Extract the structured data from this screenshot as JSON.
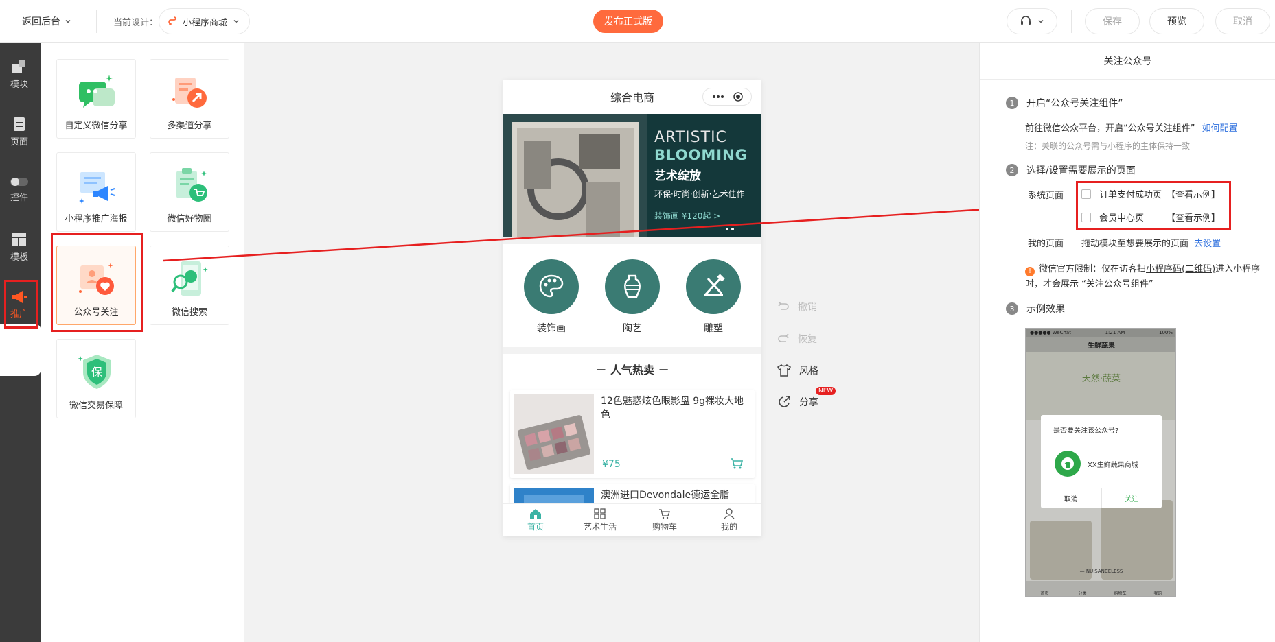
{
  "topbar": {
    "back_label": "返回后台",
    "current_design_label": "当前设计：",
    "design_name": "小程序商城",
    "publish_label": "发布正式版",
    "save_label": "保存",
    "preview_label": "预览",
    "cancel_label": "取消"
  },
  "leftnav": {
    "items": [
      {
        "label": "模块",
        "icon": "module-icon"
      },
      {
        "label": "页面",
        "icon": "page-icon"
      },
      {
        "label": "控件",
        "icon": "toggle-icon"
      },
      {
        "label": "模板",
        "icon": "template-icon"
      },
      {
        "label": "推广",
        "icon": "megaphone-icon",
        "active": true
      }
    ]
  },
  "components": [
    {
      "label": "自定义微信分享",
      "icon": "wechat-share-icon"
    },
    {
      "label": "多渠道分享",
      "icon": "multi-channel-share-icon"
    },
    {
      "label": "小程序推广海报",
      "icon": "promo-poster-icon"
    },
    {
      "label": "微信好物圈",
      "icon": "wechat-goods-circle-icon"
    },
    {
      "label": "公众号关注",
      "icon": "official-account-follow-icon",
      "selected": true
    },
    {
      "label": "微信搜索",
      "icon": "wechat-search-icon"
    },
    {
      "label": "微信交易保障",
      "icon": "trade-guarantee-icon"
    }
  ],
  "phone": {
    "title": "综合电商",
    "banner": {
      "line1": "ARTISTIC",
      "line2": "BLOOMING",
      "line3": "艺术绽放",
      "line4": "环保·时尚·创新·艺术佳作",
      "line5": "装饰画 ¥120起 >"
    },
    "categories": [
      "装饰画",
      "陶艺",
      "雕塑"
    ],
    "hot_title": "－ 人气热卖 －",
    "products": [
      {
        "name": "12色魅惑炫色眼影盘 9g裸妆大地色",
        "price": "¥75"
      },
      {
        "name": "澳洲进口Devondale德运全脂",
        "price": ""
      }
    ],
    "tabs": [
      "首页",
      "艺术生活",
      "购物车",
      "我的"
    ]
  },
  "tools": {
    "undo": "撤销",
    "redo": "恢复",
    "style": "风格",
    "share": "分享",
    "new_badge": "NEW"
  },
  "rpanel": {
    "title": "关注公众号",
    "step1": {
      "num": "1",
      "title": "开启“公众号关注组件”"
    },
    "step1_desc_a": "前往",
    "step1_desc_link": "微信公众平台",
    "step1_desc_b": "，开启“公众号关注组件”",
    "step1_howto": "如何配置",
    "step1_note": "注：关联的公众号需与小程序的主体保持一致",
    "step2": {
      "num": "2",
      "title": "选择/设置需要展示的页面"
    },
    "system_page_label": "系统页面",
    "options": [
      {
        "label": "订单支付成功页",
        "example": "【查看示例】"
      },
      {
        "label": "会员中心页",
        "example": "【查看示例】"
      }
    ],
    "my_page_label": "我的页面",
    "my_page_desc": "拖动模块至想要展示的页面",
    "my_page_link": "去设置",
    "limit_a": "微信官方限制：仅在访客扫",
    "limit_link": "小程序码(二维码)",
    "limit_b": "进入小程序",
    "limit_c": "时，才会展示 “关注公众号组件”",
    "step3": {
      "num": "3",
      "title": "示例效果"
    },
    "example": {
      "status_left": "●●●●● WeChat",
      "status_time": "1:21 AM",
      "status_right": "100%",
      "nav_title": "生鲜蔬果",
      "hero_text": "天然·蔬菜",
      "dialog_question": "是否要关注该公众号?",
      "shop_name": "XX生鲜蔬果商城",
      "cancel": "取消",
      "follow": "关注",
      "caption": "— NUISANCELESS",
      "tabs": [
        "首页",
        "分类",
        "购物车",
        "我的"
      ]
    }
  },
  "colors": {
    "publish": "#ff6a3d",
    "accent_teal": "#3bb3a5",
    "highlight_red": "#e62020",
    "link_blue": "#2d6fde"
  }
}
